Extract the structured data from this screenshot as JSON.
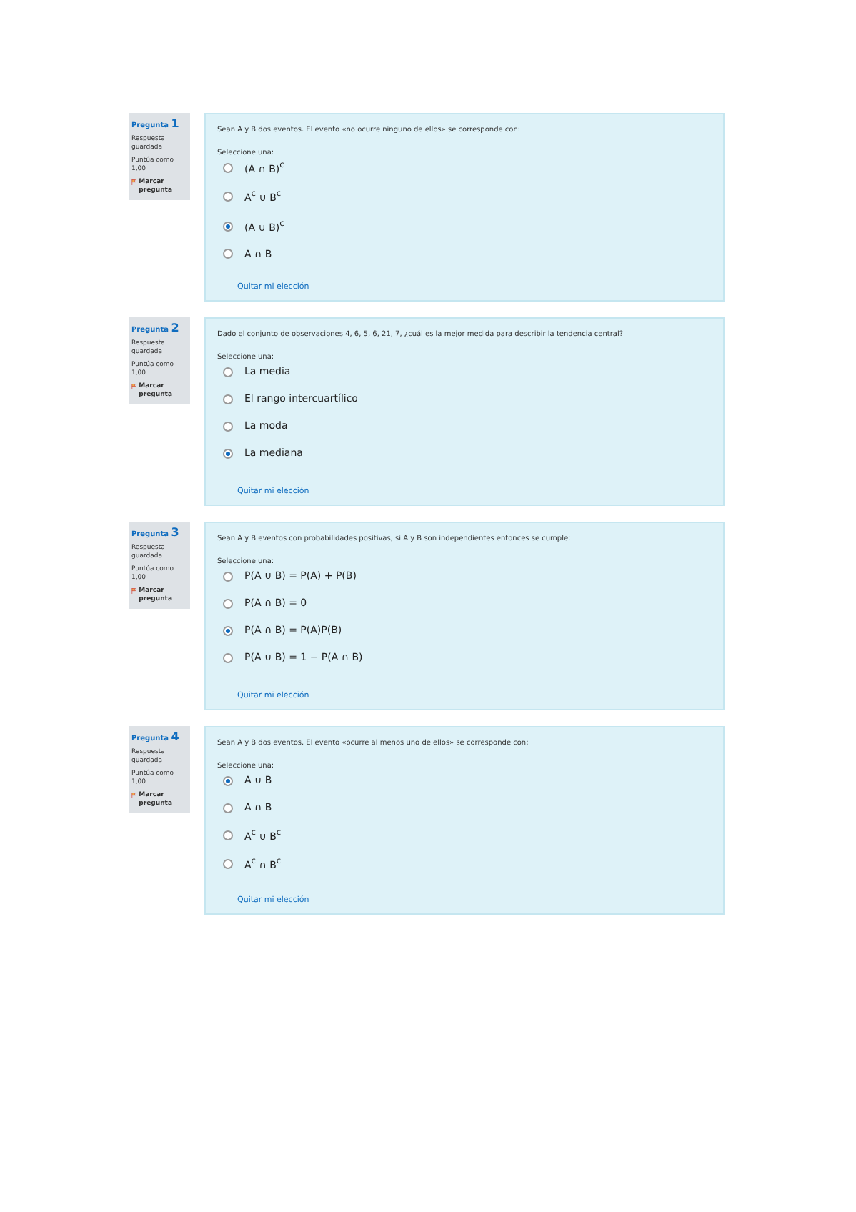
{
  "questions": [
    {
      "number_label": "Pregunta",
      "number": "1",
      "status": "Respuesta guardada",
      "score": "Puntúa como 1,00",
      "flag_label": "Marcar pregunta",
      "text": "Sean A y B dos eventos. El evento «no ocurre ninguno de ellos» se corresponde con:",
      "prompt": "Seleccione una:",
      "options": [
        {
          "label": "(A ∩ B)$^{c}$",
          "selected": false
        },
        {
          "label": "A$^{c}$ ∪ B$^{c}$",
          "selected": false
        },
        {
          "label": "(A ∪ B)$^{c}$",
          "selected": true
        },
        {
          "label": "A ∩ B",
          "selected": false
        }
      ],
      "clear_link": "Quitar mi elección"
    },
    {
      "number_label": "Pregunta",
      "number": "2",
      "status": "Respuesta guardada",
      "score": "Puntúa como 1,00",
      "flag_label": "Marcar pregunta",
      "text": "Dado el conjunto de observaciones 4, 6, 5, 6, 21, 7, ¿cuál es la mejor medida para describir la tendencia central?",
      "prompt": "Seleccione una:",
      "options": [
        {
          "label": "La media",
          "selected": false
        },
        {
          "label": "El rango intercuartílico",
          "selected": false
        },
        {
          "label": "La moda",
          "selected": false
        },
        {
          "label": "La mediana",
          "selected": true
        }
      ],
      "clear_link": "Quitar mi elección"
    },
    {
      "number_label": "Pregunta",
      "number": "3",
      "status": "Respuesta guardada",
      "score": "Puntúa como 1,00",
      "flag_label": "Marcar pregunta",
      "text": "Sean A y B eventos con probabilidades positivas, si A y B son independientes entonces se cumple:",
      "prompt": "Seleccione una:",
      "options": [
        {
          "label": "P(A ∪ B) = P(A) + P(B)",
          "selected": false
        },
        {
          "label": "P(A ∩ B) = 0",
          "selected": false
        },
        {
          "label": "P(A ∩ B) = P(A)P(B)",
          "selected": true
        },
        {
          "label": "P(A ∪ B) = 1 − P(A ∩ B)",
          "selected": false
        }
      ],
      "clear_link": "Quitar mi elección"
    },
    {
      "number_label": "Pregunta",
      "number": "4",
      "status": "Respuesta guardada",
      "score": "Puntúa como 1,00",
      "flag_label": "Marcar pregunta",
      "text": "Sean A y B dos eventos. El evento «ocurre al menos uno de ellos» se corresponde con:",
      "prompt": "Seleccione una:",
      "options": [
        {
          "label": "A ∪ B",
          "selected": true
        },
        {
          "label": "A ∩ B",
          "selected": false
        },
        {
          "label": "A$^{c}$ ∪ B$^{c}$",
          "selected": false
        },
        {
          "label": "A$^{c}$ ∩ B$^{c}$",
          "selected": false
        }
      ],
      "clear_link": "Quitar mi elección"
    }
  ]
}
